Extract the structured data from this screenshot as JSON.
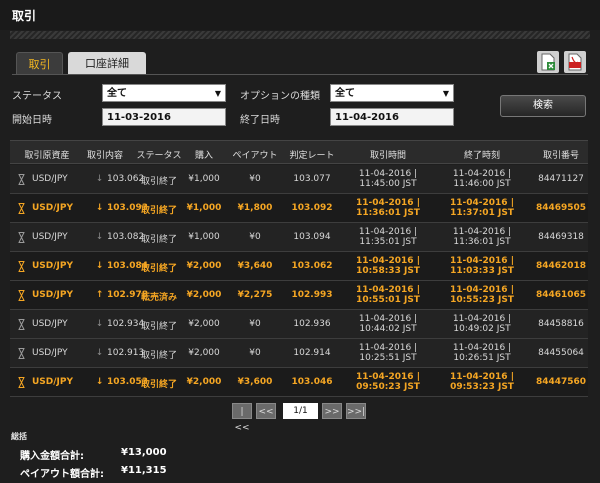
{
  "page": {
    "title": "取引"
  },
  "tabs": [
    {
      "label": "取引",
      "active": true
    },
    {
      "label": "口座詳細",
      "active": false
    }
  ],
  "toolbar": {
    "icons": [
      "excel-export-icon",
      "pdf-export-icon"
    ]
  },
  "filters": {
    "status_label": "ステータス",
    "status_value": "全て",
    "option_type_label": "オプションの種類",
    "option_type_value": "全て",
    "start_date_label": "開始日時",
    "start_date_value": "11-03-2016",
    "end_date_label": "終了日時",
    "end_date_value": "11-04-2016",
    "search_label": "検索"
  },
  "table": {
    "columns": [
      "取引原資産",
      "取引内容",
      "ステータス",
      "購入",
      "ペイアウト",
      "判定レート",
      "取引時間",
      "終了時刻",
      "取引番号"
    ],
    "rows": [
      {
        "asset": "USD/JPY",
        "direction": "down",
        "rate": "103.062",
        "status": "取引終了",
        "purchase": "¥1,000",
        "payout": "¥0",
        "judge": "103.077",
        "trade_date": "11-04-2016 |",
        "trade_time": "11:45:00 JST",
        "end_date": "11-04-2016 |",
        "end_time": "11:46:00 JST",
        "id": "84471127",
        "highlight": false
      },
      {
        "asset": "USD/JPY",
        "direction": "down",
        "rate": "103.093",
        "status": "取引終了",
        "purchase": "¥1,000",
        "payout": "¥1,800",
        "judge": "103.092",
        "trade_date": "11-04-2016 |",
        "trade_time": "11:36:01 JST",
        "end_date": "11-04-2016 |",
        "end_time": "11:37:01 JST",
        "id": "84469505",
        "highlight": true
      },
      {
        "asset": "USD/JPY",
        "direction": "down",
        "rate": "103.082",
        "status": "取引終了",
        "purchase": "¥1,000",
        "payout": "¥0",
        "judge": "103.094",
        "trade_date": "11-04-2016 |",
        "trade_time": "11:35:01 JST",
        "end_date": "11-04-2016 |",
        "end_time": "11:36:01 JST",
        "id": "84469318",
        "highlight": false
      },
      {
        "asset": "USD/JPY",
        "direction": "down",
        "rate": "103.084",
        "status": "取引終了",
        "purchase": "¥2,000",
        "payout": "¥3,640",
        "judge": "103.062",
        "trade_date": "11-04-2016 |",
        "trade_time": "10:58:33 JST",
        "end_date": "11-04-2016 |",
        "end_time": "11:03:33 JST",
        "id": "84462018",
        "highlight": true
      },
      {
        "asset": "USD/JPY",
        "direction": "up",
        "rate": "102.978",
        "status": "転売済み",
        "purchase": "¥2,000",
        "payout": "¥2,275",
        "judge": "102.993",
        "trade_date": "11-04-2016 |",
        "trade_time": "10:55:01 JST",
        "end_date": "11-04-2016 |",
        "end_time": "10:55:23 JST",
        "id": "84461065",
        "highlight": true
      },
      {
        "asset": "USD/JPY",
        "direction": "down",
        "rate": "102.934",
        "status": "取引終了",
        "purchase": "¥2,000",
        "payout": "¥0",
        "judge": "102.936",
        "trade_date": "11-04-2016 |",
        "trade_time": "10:44:02 JST",
        "end_date": "11-04-2016 |",
        "end_time": "10:49:02 JST",
        "id": "84458816",
        "highlight": false
      },
      {
        "asset": "USD/JPY",
        "direction": "down",
        "rate": "102.913",
        "status": "取引終了",
        "purchase": "¥2,000",
        "payout": "¥0",
        "judge": "102.914",
        "trade_date": "11-04-2016 |",
        "trade_time": "10:25:51 JST",
        "end_date": "11-04-2016 |",
        "end_time": "10:26:51 JST",
        "id": "84455064",
        "highlight": false
      },
      {
        "asset": "USD/JPY",
        "direction": "down",
        "rate": "103.053",
        "status": "取引終了",
        "purchase": "¥2,000",
        "payout": "¥3,600",
        "judge": "103.046",
        "trade_date": "11-04-2016 |",
        "trade_time": "09:50:23 JST",
        "end_date": "11-04-2016 |",
        "end_time": "09:53:23 JST",
        "id": "84447560",
        "highlight": true
      }
    ]
  },
  "pagination": {
    "first": "|<<",
    "prev": "<<",
    "info": "1/1",
    "next": ">>",
    "last": ">>|"
  },
  "summary": {
    "title": "総括",
    "purchase_total_label": "購入金額合計:",
    "purchase_total_value": "¥13,000",
    "payout_total_label": "ペイアウト額合計:",
    "payout_total_value": "¥11,315"
  },
  "colors": {
    "highlight": "#f5a623",
    "text": "#d8d8d8",
    "background": "#1e1e1e"
  }
}
